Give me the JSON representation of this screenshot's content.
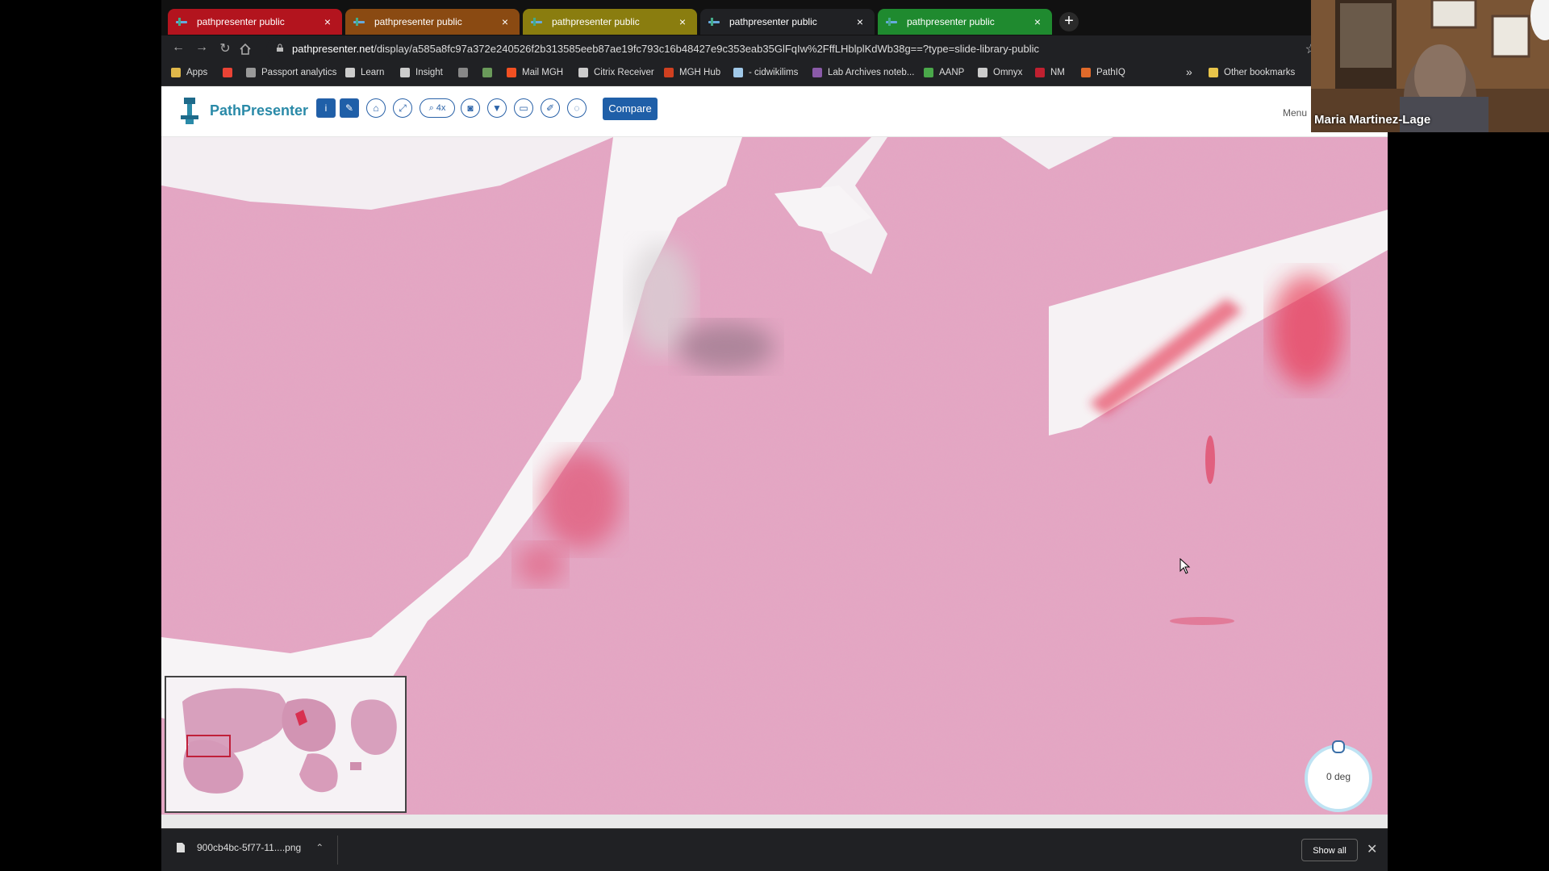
{
  "tabs": [
    {
      "title": "pathpresenter public",
      "color": "#b3141e",
      "active": false
    },
    {
      "title": "pathpresenter public",
      "color": "#8a4a12",
      "active": false
    },
    {
      "title": "pathpresenter public",
      "color": "#8a7d0f",
      "active": false
    },
    {
      "title": "pathpresenter public",
      "color": "#202124",
      "active": true
    },
    {
      "title": "pathpresenter public",
      "color": "#1f8a2f",
      "active": false
    }
  ],
  "address": {
    "domain": "pathpresenter.net",
    "path": "/display/a585a8fc97a372e240526f2b313585eeb87ae19fc793c16b48427e9c353eab35GlFqIw%2FffLHblplKdWb38g==?type=slide-library-public"
  },
  "bookmarks": [
    {
      "label": "Apps",
      "icon_color": "#e0b84a"
    },
    {
      "label": "",
      "icon_color": "#ea4335"
    },
    {
      "label": "Passport analytics",
      "icon_color": "#999999"
    },
    {
      "label": "Learn",
      "icon_color": "#cccccc"
    },
    {
      "label": "Insight",
      "icon_color": "#cccccc"
    },
    {
      "label": "",
      "icon_color": "#888888"
    },
    {
      "label": "",
      "icon_color": "#6a9a5a"
    },
    {
      "label": "Mail MGH",
      "icon_color": "#f25022"
    },
    {
      "label": "Citrix Receiver",
      "icon_color": "#cccccc"
    },
    {
      "label": "MGH Hub",
      "icon_color": "#d04020"
    },
    {
      "label": "- cidwikilims",
      "icon_color": "#a0c8e8"
    },
    {
      "label": "Lab Archives noteb...",
      "icon_color": "#8a5aa8"
    },
    {
      "label": "AANP",
      "icon_color": "#4aa84a"
    },
    {
      "label": "Omnyx",
      "icon_color": "#cccccc"
    },
    {
      "label": "NM",
      "icon_color": "#c02030"
    },
    {
      "label": "PathIQ",
      "icon_color": "#e06a2a"
    }
  ],
  "bookmarks_overflow": "»",
  "other_bookmarks": "Other bookmarks",
  "app": {
    "logo_text": "PathPresenter",
    "zoom_label": "4x",
    "compare_label": "Compare",
    "menu_text": "Menu"
  },
  "rotation": {
    "label": "0 deg"
  },
  "download": {
    "filename": "900cb4bc-5f77-11....png",
    "show_all": "Show all"
  },
  "webcam": {
    "name": "Maria Martinez-Lage"
  }
}
